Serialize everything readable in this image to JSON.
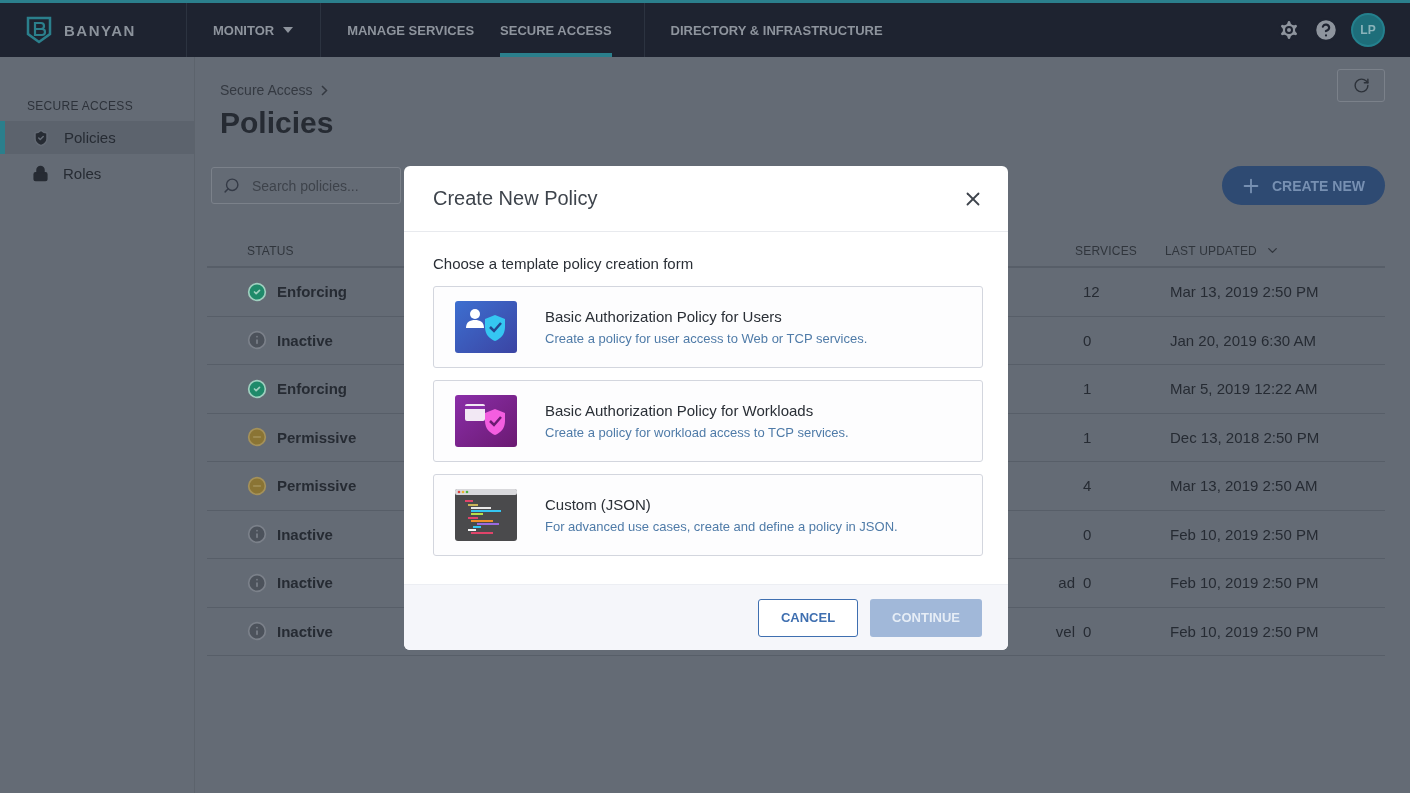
{
  "topbar": {
    "brand": "BANYAN",
    "nav": [
      {
        "label": "MONITOR",
        "dropdown": true,
        "selected": false
      },
      {
        "label": "MANAGE SERVICES",
        "dropdown": false,
        "selected": false
      },
      {
        "label": "SECURE ACCESS",
        "dropdown": false,
        "selected": true
      },
      {
        "label": "DIRECTORY & INFRASTRUCTURE",
        "dropdown": false,
        "selected": false
      }
    ],
    "avatar": "LP"
  },
  "sidebar": {
    "heading": "SECURE ACCESS",
    "items": [
      {
        "label": "Policies",
        "kind": "shield",
        "selected": true
      },
      {
        "label": "Roles",
        "kind": "lock",
        "selected": false
      }
    ]
  },
  "breadcrumb": "Secure Access",
  "title": "Policies",
  "search": {
    "placeholder": "Search policies..."
  },
  "create_button": "CREATE NEW",
  "table": {
    "columns": [
      "STATUS",
      "SERVICES",
      "LAST UPDATED"
    ],
    "rows": [
      {
        "status": "Enforcing",
        "kind": "enforcing",
        "services": "12",
        "last_updated": "Mar 13, 2019 2:50 PM"
      },
      {
        "status": "Inactive",
        "kind": "inactive",
        "services": "0",
        "last_updated": "Jan 20, 2019 6:30 AM"
      },
      {
        "status": "Enforcing",
        "kind": "enforcing",
        "services": "1",
        "last_updated": "Mar 5, 2019 12:22 AM"
      },
      {
        "status": "Permissive",
        "kind": "permissive",
        "services": "1",
        "last_updated": "Dec 13, 2018 2:50 PM"
      },
      {
        "status": "Permissive",
        "kind": "permissive",
        "services": "4",
        "last_updated": "Mar 13, 2019 2:50 AM"
      },
      {
        "status": "Inactive",
        "kind": "inactive",
        "services": "0",
        "last_updated": "Feb 10, 2019 2:50 PM"
      },
      {
        "status": "Inactive",
        "kind": "inactive",
        "column_3": "ad",
        "services": "0",
        "last_updated": "Feb 10, 2019 2:50 PM"
      },
      {
        "status": "Inactive",
        "kind": "inactive",
        "column_3": "vel",
        "services": "0",
        "last_updated": "Feb 10, 2019 2:50 PM"
      }
    ]
  },
  "modal": {
    "title": "Create New Policy",
    "prompt": "Choose a template policy creation form",
    "options": [
      {
        "kind": "users",
        "title": "Basic Authorization Policy for Users",
        "description": "Create a policy for user access to Web or TCP services."
      },
      {
        "kind": "workloads",
        "title": "Basic Authorization Policy for Workloads",
        "description": "Create a policy for workload access to TCP services."
      },
      {
        "kind": "json",
        "title": "Custom (JSON)",
        "description": "For advanced use cases, create and define a policy in JSON."
      }
    ],
    "cancel": "CANCEL",
    "continue": {
      "label": "CONTINUE",
      "disabled": true
    }
  }
}
